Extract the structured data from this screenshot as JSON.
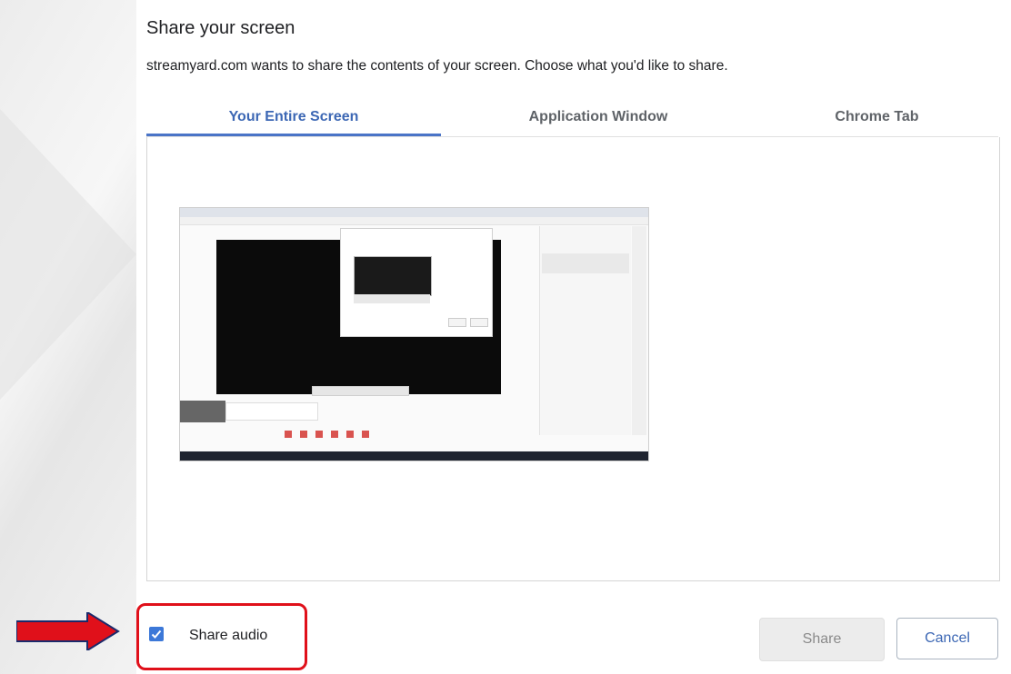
{
  "dialog": {
    "title": "Share your screen",
    "subtitle": "streamyard.com wants to share the contents of your screen. Choose what you'd like to share."
  },
  "tabs": [
    {
      "label": "Your Entire Screen",
      "active": true
    },
    {
      "label": "Application Window",
      "active": false
    },
    {
      "label": "Chrome Tab",
      "active": false
    }
  ],
  "content": {
    "thumbnail_icon": "screen-thumbnail"
  },
  "footer": {
    "share_audio_label": "Share audio",
    "share_audio_checked": true,
    "share_button": "Share",
    "cancel_button": "Cancel"
  },
  "annotation": {
    "highlight_color": "#e0101a",
    "arrow_color": "#e0101a"
  },
  "colors": {
    "accent": "#3c67b4",
    "checkbox": "#3c78d8"
  }
}
